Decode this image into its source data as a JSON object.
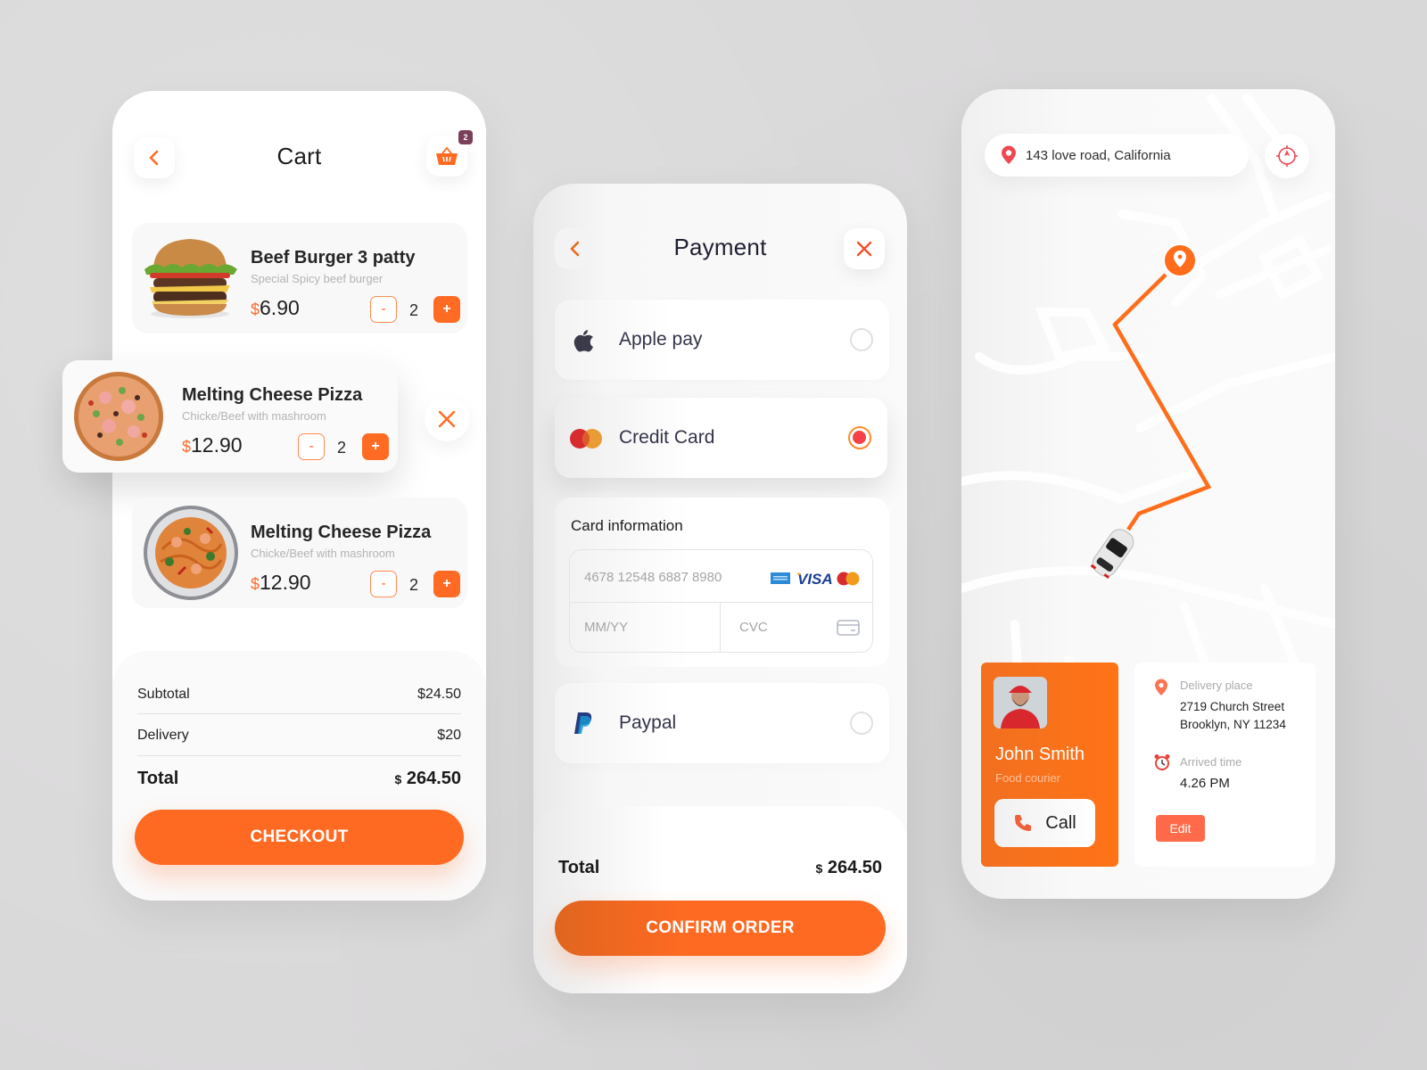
{
  "colors": {
    "accent": "#ff6a22",
    "badge": "#7a3f5a",
    "radio_selected": "#f5404a",
    "edit": "#ff6b4a"
  },
  "cart": {
    "title": "Cart",
    "back_icon": "chevron-left-icon",
    "basket_icon": "basket-icon",
    "basket_badge": "2",
    "items": [
      {
        "name": "Beef Burger 3 patty",
        "description": "Special Spicy beef burger",
        "currency": "$",
        "price": "6.90",
        "quantity": "2",
        "minus": "-",
        "plus": "+"
      },
      {
        "name": "Melting Cheese  Pizza",
        "description": "Chicke/Beef with mashroom",
        "currency": "$",
        "price": "12.90",
        "quantity": "2",
        "minus": "-",
        "plus": "+"
      },
      {
        "name": "Melting Cheese  Pizza",
        "description": "Chicke/Beef with mashroom",
        "currency": "$",
        "price": "12.90",
        "quantity": "2",
        "minus": "-",
        "plus": "+"
      }
    ],
    "summary": {
      "subtotal_label": "Subtotal",
      "subtotal_value": "$24.50",
      "delivery_label": "Delivery",
      "delivery_value": "$20",
      "total_label": "Total",
      "total_currency": "$",
      "total_value": "264.50"
    },
    "checkout_label": "CHECKOUT"
  },
  "payment": {
    "title": "Payment",
    "options": [
      {
        "label": "Apple pay",
        "icon": "apple-icon",
        "selected": false
      },
      {
        "label": "Credit Card",
        "icon": "mastercard-icon",
        "selected": true
      },
      {
        "label": "Paypal",
        "icon": "paypal-icon",
        "selected": false
      }
    ],
    "card_info": {
      "title": "Card information",
      "number_placeholder": "4678 12548 6887 8980",
      "expiry_placeholder": "MM/YY",
      "cvc_placeholder": "CVC",
      "brands": [
        "amex",
        "VISA",
        "mastercard"
      ]
    },
    "total_label": "Total",
    "total_currency": "$",
    "total_value": "264.50",
    "confirm_label": "CONFIRM ORDER"
  },
  "tracking": {
    "address": "143 love road, California",
    "courier": {
      "name": "John Smith",
      "role": "Food courier",
      "call_label": "Call"
    },
    "delivery": {
      "place_label": "Delivery place",
      "place_line1": "2719 Church Street",
      "place_line2": "Brooklyn, NY 11234",
      "time_label": "Arrived time",
      "time_value": "4.26 PM",
      "edit_label": "Edit"
    }
  }
}
